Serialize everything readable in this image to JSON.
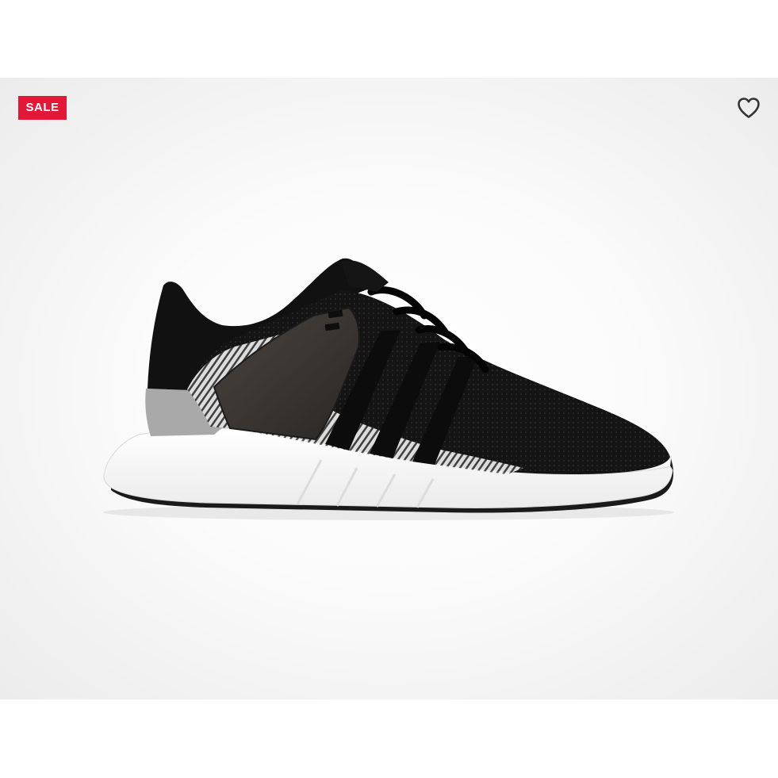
{
  "badge": {
    "label": "SALE",
    "color": "#e31837",
    "text_color": "#ffffff"
  },
  "favorite": {
    "icon": "heart-outline-icon",
    "color": "#333333"
  },
  "product": {
    "image_subject": "sneaker",
    "colors": {
      "upper": "#111111",
      "sole": "#ffffff",
      "heel_tab": "#a9a9a9",
      "cage": "#3b3632"
    }
  }
}
